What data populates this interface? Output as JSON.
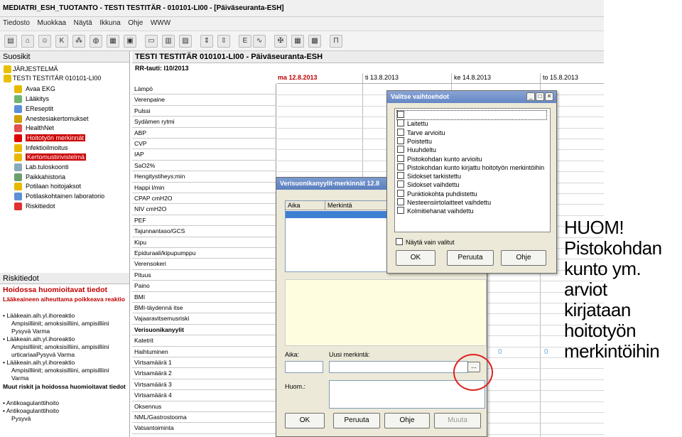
{
  "window": {
    "title": "MEDIATRI_ESH_TUOTANTO - TESTI TESTITÄR - 010101-LI00 - [Päiväseuranta-ESH]"
  },
  "menu": [
    "Tiedosto",
    "Muokkaa",
    "Näytä",
    "Ikkuna",
    "Ohje",
    "WWW"
  ],
  "favorites": {
    "header": "Suosikit",
    "root": "JÄRJESTELMÄ",
    "patient": "TESTI TESTITÄR  010101-LI00",
    "items": [
      "Avaa EKG",
      "Lääkitys",
      "EReseptit",
      "Anestesiakertomukset",
      "HealthNet",
      "Hoitotyön merkinnät",
      "Infektioilmoitus",
      "Kertomustirivistelmä",
      "Lab.tuloskoonti",
      "Paikkahistoria",
      "Potilaan hoitojaksot",
      "Potilaskohtainen laboratorio",
      "Riskitiedot"
    ]
  },
  "risks": {
    "header": "Riskitiedot",
    "title": "Hoidossa huomioitavat tiedot",
    "subtitle": "Lääkeaineen aiheuttama poikkeava reaktio",
    "lines": [
      "Lääkeain.aih.yl.ihoreaktio",
      "Ampisilliinit; amoksisilliini, ampisilliini",
      "Pysyvä Varma",
      "Lääkeain.aih.yl.ihoreaktio",
      "Ampisilliinit; amoksisilliini, ampisilliini",
      "urticariaaPysyvä Varma",
      "Lääkeain.aih.yl.ihoreaktio",
      "Ampisilliinit; amoksisilliini, ampisilliini",
      "Varma"
    ],
    "other_title": "Muut riskit ja hoidossa huomioitavat tiedot",
    "other_lines": [
      "Antikoagulanttihoito",
      "Antikoagulanttihoito",
      "Pysyvä"
    ]
  },
  "main": {
    "header": "TESTI TESTITÄR 010101-LI00 - Päiväseuranta-ESH",
    "subheader": "RR-tauti: I10/2013",
    "dates": [
      "ma 12.8.2013",
      "ti 13.8.2013",
      "ke 14.8.2013",
      "to 15.8.2013"
    ],
    "vitals": [
      "Lämpö",
      "Verenpaine",
      "Pulssi",
      "Sydämen rytmi",
      "ABP",
      "CVP",
      "IAP",
      "SaO2%",
      "Hengitystiheys:min",
      "Happi l/min",
      "CPAP cmH2O",
      "NIV cmH2O",
      "PEF",
      "Tajunnantaso/GCS",
      "Kipu",
      "Epiduraali/kipupumppu",
      "Verensokeri",
      "Pituus",
      "Paino",
      "BMI",
      "BMI-täydennä itse",
      "Vajaaravitsemusriski",
      "Verisuonikanyylit",
      "Katetrit",
      "Haihtuminen",
      "Virtsamäärä 1",
      "Virtsamäärä 2",
      "Virtsamäärä 3",
      "Virtsamäärä 4",
      "Oksennus",
      "NML/Gastrostooma",
      "Vatsantoiminta"
    ],
    "selected_vital": "Verisuonikanyylit",
    "cell_values": [
      "0",
      "0"
    ]
  },
  "dialog_merkinnat": {
    "title": "Verisuonikanyylit-merkinnät 12.8",
    "col_aika": "Aika",
    "col_merkinta": "Merkintä",
    "aika_label": "Aika:",
    "uusi_label": "Uusi merkintä:",
    "huom_label": "Huom.:",
    "dots": "...",
    "buttons": [
      "OK",
      "Peruuta",
      "Ohje",
      "Muuta"
    ]
  },
  "dialog_vaihto": {
    "title": "Valitse vaihtoehdot",
    "options": [
      "",
      "Laitettu",
      "Tarve arvioitu",
      "Poistettu",
      "Huuhdeltu",
      "Pistokohdan kunto arvioitu",
      "Pistokohdan kunto kirjattu hoitotyön merkintöihin",
      "Sidokset tarkistettu",
      "Sidokset vaihdettu",
      "Punktiokohta puhdistettu",
      "Nesteensiirtolaitteet vaihdettu",
      "Kolmitiehanat vaihdettu"
    ],
    "only_selected": "Näytä vain valitut",
    "buttons": [
      "OK",
      "Peruuta",
      "Ohje"
    ]
  },
  "annotation": {
    "lines": [
      "HUOM!",
      "Pistokohdan",
      "kunto ym.",
      "arviot",
      "kirjataan",
      "hoitotyön",
      "merkintöihin"
    ],
    "color": "#e02020"
  },
  "colors": {
    "highlight": "#cc0000",
    "titlebar": "#5a7fbf",
    "note_panel": "#fffde0"
  }
}
